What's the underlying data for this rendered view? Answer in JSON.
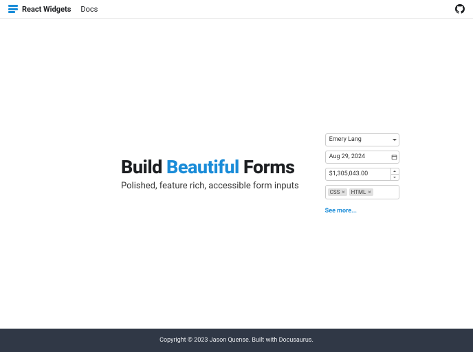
{
  "nav": {
    "brand": "React Widgets",
    "docs": "Docs"
  },
  "hero": {
    "title_pre": "Build ",
    "title_accent": "Beautiful",
    "title_post": " Forms",
    "subtitle": "Polished, feature rich, accessible form inputs"
  },
  "widgets": {
    "dropdown_value": "Emery Lang",
    "date_value": "Aug 29, 2024",
    "number_value": "$1,305,043.00",
    "tags": [
      "CSS",
      "HTML"
    ],
    "see_more": "See more..."
  },
  "footer": {
    "copyright": "Copyright © 2023 Jason Quense. Built with Docusaurus."
  }
}
